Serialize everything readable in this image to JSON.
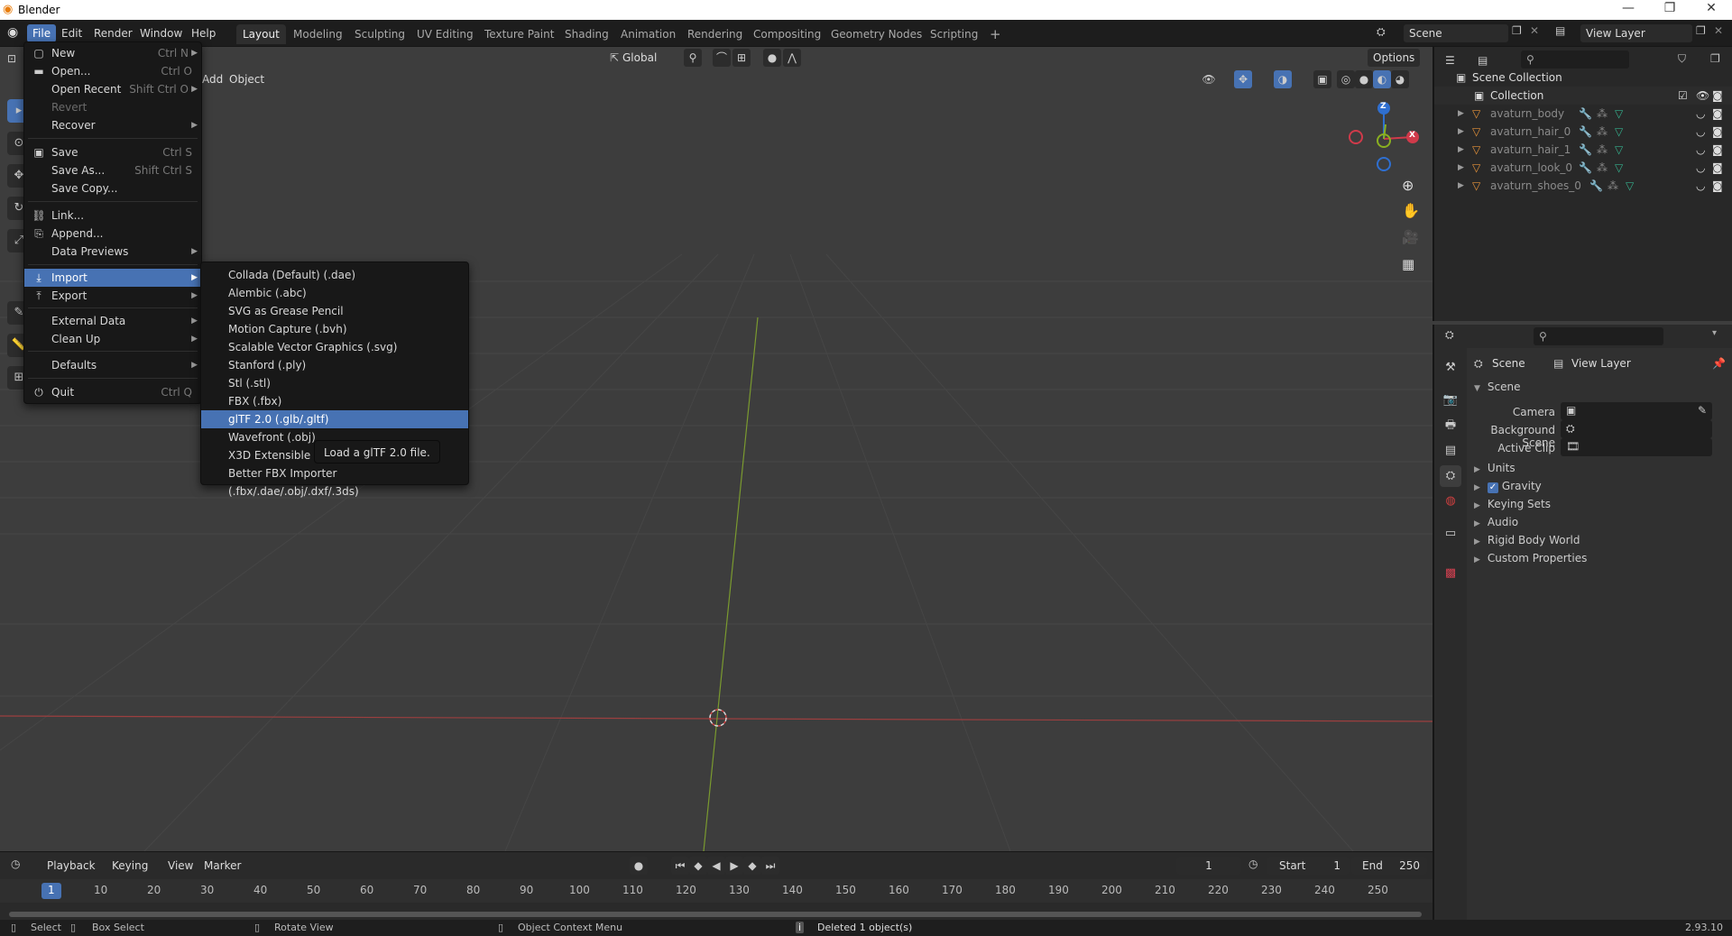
{
  "window": {
    "title": "Blender",
    "minimize": "—",
    "restore": "❐",
    "close": "✕"
  },
  "menubar": {
    "items": [
      "File",
      "Edit",
      "Render",
      "Window",
      "Help"
    ],
    "active": "File"
  },
  "workspaces": {
    "tabs": [
      "Layout",
      "Modeling",
      "Sculpting",
      "UV Editing",
      "Texture Paint",
      "Shading",
      "Animation",
      "Rendering",
      "Compositing",
      "Geometry Nodes",
      "Scripting"
    ],
    "active": "Layout",
    "add": "+"
  },
  "scene_selector": {
    "value": "Scene"
  },
  "viewlayer_selector": {
    "value": "View Layer"
  },
  "viewport": {
    "transform_orientation": "Global",
    "options_label": "Options",
    "header_add": "Add",
    "header_object": "Object",
    "gizmo": {
      "z": "Z",
      "x": "X"
    }
  },
  "file_menu": {
    "items": [
      {
        "label": "New",
        "shortcut": "Ctrl N",
        "submenu": true,
        "icon": "new-file-icon"
      },
      {
        "label": "Open...",
        "shortcut": "Ctrl O",
        "icon": "folder-icon"
      },
      {
        "label": "Open Recent",
        "shortcut": "Shift Ctrl O",
        "submenu": true
      },
      {
        "label": "Revert",
        "disabled": true
      },
      {
        "label": "Recover",
        "submenu": true
      },
      {
        "label": "Save",
        "shortcut": "Ctrl S",
        "icon": "save-icon"
      },
      {
        "label": "Save As...",
        "shortcut": "Shift Ctrl S"
      },
      {
        "label": "Save Copy..."
      },
      {
        "label": "Link...",
        "icon": "link-icon"
      },
      {
        "label": "Append...",
        "icon": "append-icon"
      },
      {
        "label": "Data Previews",
        "submenu": true
      },
      {
        "label": "Import",
        "submenu": true,
        "highlighted": true,
        "icon": "import-icon"
      },
      {
        "label": "Export",
        "submenu": true,
        "icon": "export-icon"
      },
      {
        "label": "External Data",
        "submenu": true
      },
      {
        "label": "Clean Up",
        "submenu": true
      },
      {
        "label": "Defaults",
        "submenu": true
      },
      {
        "label": "Quit",
        "shortcut": "Ctrl Q",
        "icon": "power-icon"
      }
    ]
  },
  "import_menu": {
    "items": [
      "Collada (Default) (.dae)",
      "Alembic (.abc)",
      "SVG as Grease Pencil",
      "Motion Capture (.bvh)",
      "Scalable Vector Graphics (.svg)",
      "Stanford (.ply)",
      "Stl (.stl)",
      "FBX (.fbx)",
      "glTF 2.0 (.glb/.gltf)",
      "Wavefront (.obj)",
      "X3D Extensible 3D",
      "Better FBX Importer (.fbx/.dae/.obj/.dxf/.3ds)"
    ],
    "highlighted": "glTF 2.0 (.glb/.gltf)"
  },
  "tooltip": {
    "text": "Load a glTF 2.0 file."
  },
  "outliner": {
    "root": "Scene Collection",
    "collection": "Collection",
    "objects": [
      "avaturn_body",
      "avaturn_hair_0",
      "avaturn_hair_1",
      "avaturn_look_0",
      "avaturn_shoes_0"
    ]
  },
  "properties": {
    "breadcrumb_scene": "Scene",
    "breadcrumb_viewlayer": "View Layer",
    "section": "Scene",
    "fields": [
      {
        "label": "Camera"
      },
      {
        "label": "Background Scene"
      },
      {
        "label": "Active Clip"
      }
    ],
    "panels": [
      "Units",
      "Gravity",
      "Keying Sets",
      "Audio",
      "Rigid Body World",
      "Custom Properties"
    ],
    "gravity_checked": true
  },
  "timeline": {
    "menus": [
      "Playback",
      "Keying",
      "View",
      "Marker"
    ],
    "current_frame": "1",
    "start_label": "Start",
    "start_value": "1",
    "end_label": "End",
    "end_value": "250",
    "ticks": [
      "1",
      "10",
      "20",
      "30",
      "40",
      "50",
      "60",
      "70",
      "80",
      "90",
      "100",
      "110",
      "120",
      "130",
      "140",
      "150",
      "160",
      "170",
      "180",
      "190",
      "200",
      "210",
      "220",
      "230",
      "240",
      "250"
    ]
  },
  "statusbar": {
    "select": "Select",
    "box_select": "Box Select",
    "rotate_view": "Rotate View",
    "context_menu": "Object Context Menu",
    "message": "Deleted 1 object(s)",
    "version": "2.93.10"
  }
}
